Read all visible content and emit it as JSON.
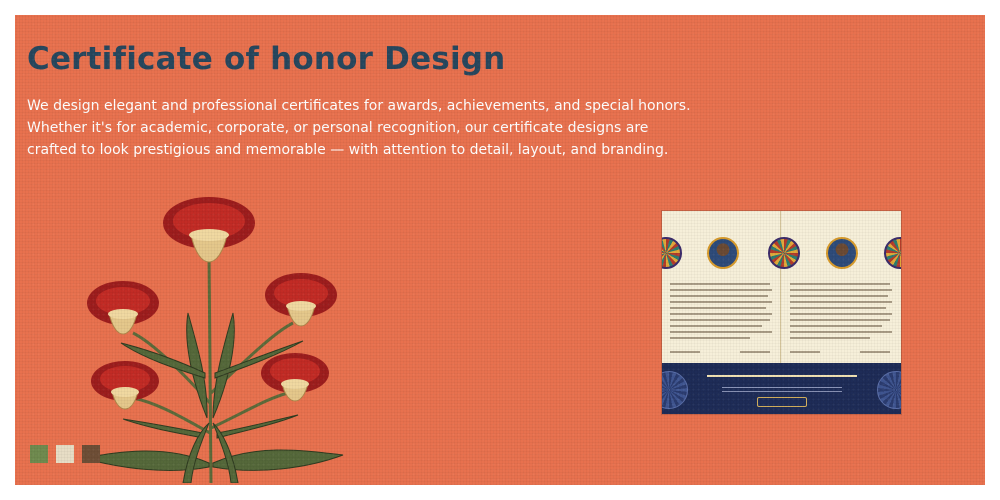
{
  "heading": "Certificate of honor Design",
  "description": [
    "We design elegant and professional certificates for awards, achievements, and special honors.",
    "Whether it's for academic, corporate, or personal recognition, our certificate designs are",
    "crafted to look prestigious and memorable — with attention to detail, layout, and branding."
  ],
  "palette": [
    "#6f8a4e",
    "#e7ddc5",
    "#6e4e36"
  ],
  "background_color": "#e8714e",
  "heading_color": "#27475e"
}
